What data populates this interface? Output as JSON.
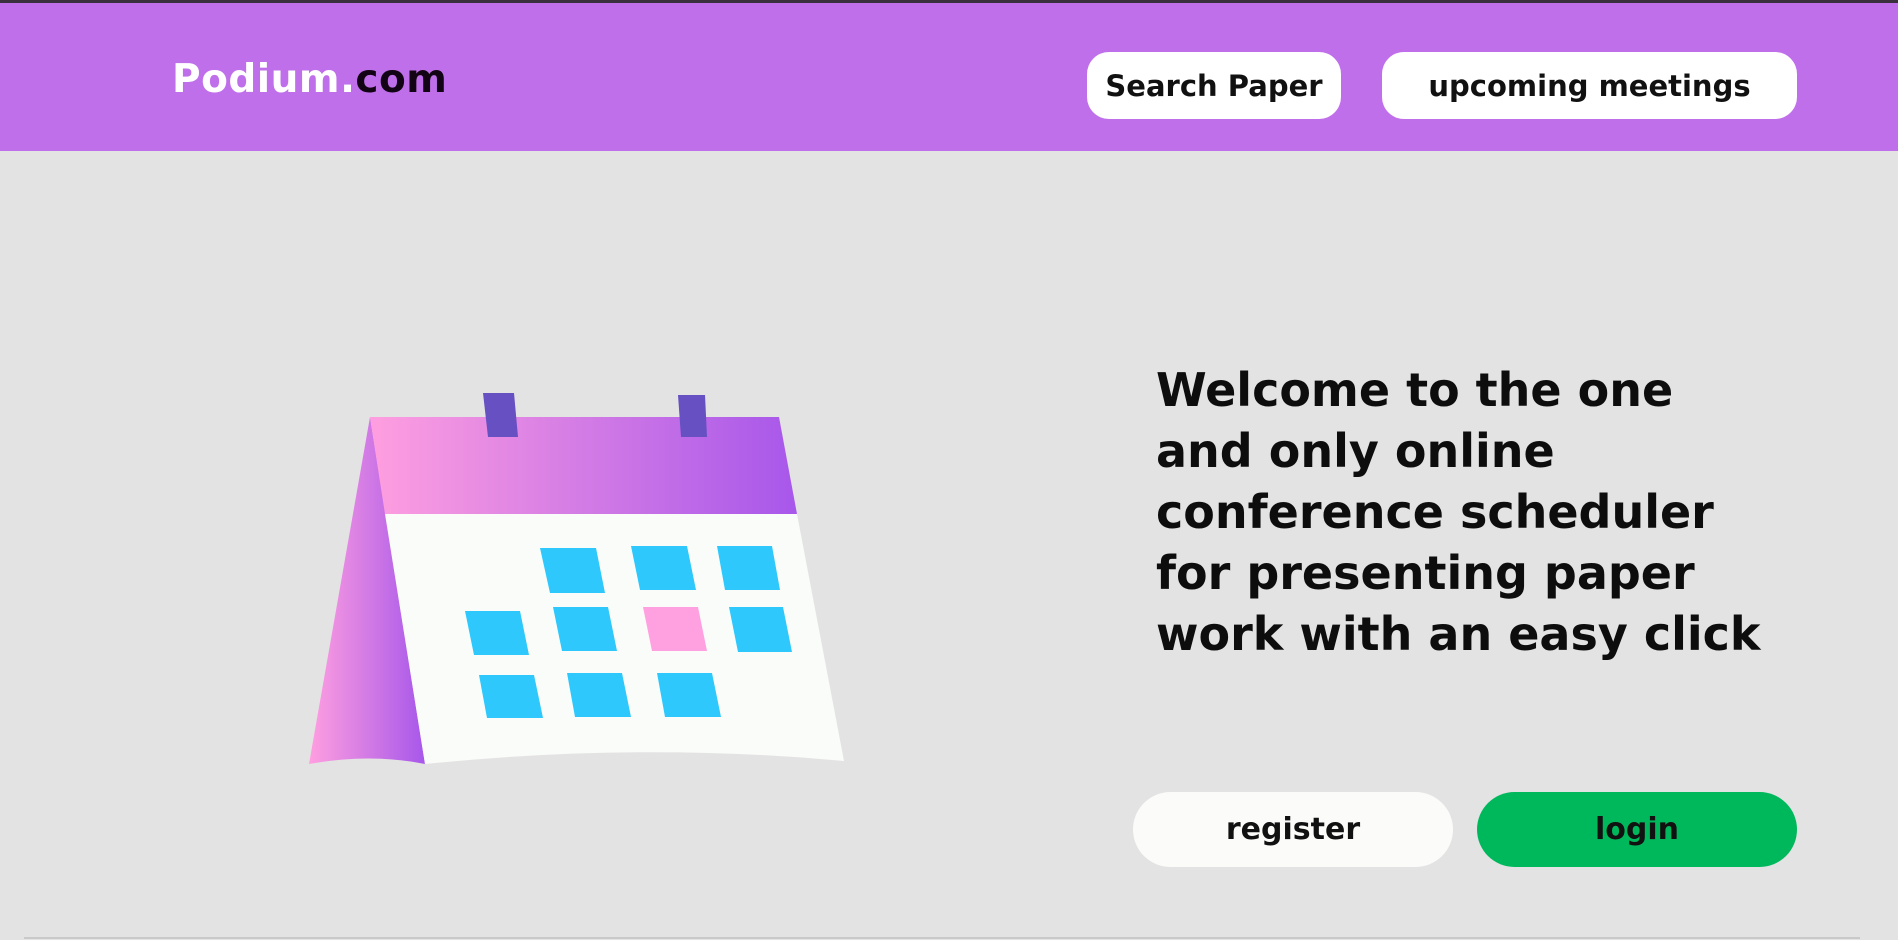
{
  "header": {
    "logo_part1": "Podium.",
    "logo_part2": "com",
    "search_paper_label": "Search Paper",
    "upcoming_meetings_label": "upcoming meetings"
  },
  "hero": {
    "welcome_text": "Welcome to the one and only online conference scheduler for presenting paper work with an easy click",
    "register_label": "register",
    "login_label": "login"
  },
  "illustration": {
    "icon": "calendar-icon"
  },
  "colors": {
    "header_bg": "#c06feb",
    "page_bg": "#e3e3e3",
    "login_green": "#00b85c",
    "calendar_cell_blue": "#2ec8fc",
    "calendar_cell_pink": "#ffa1e1"
  }
}
